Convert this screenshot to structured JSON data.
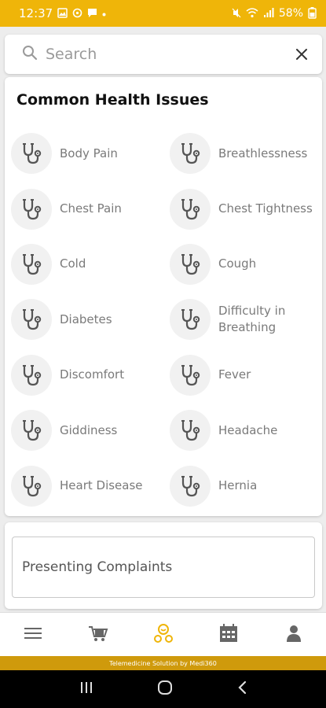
{
  "status_bar": {
    "time": "12:37",
    "battery": "58%",
    "bg_color": "#efb509"
  },
  "search": {
    "placeholder": "Search",
    "icon": "search-icon",
    "clear_icon": "close-icon"
  },
  "issues": {
    "title": "Common Health Issues",
    "icon": "stethoscope-icon",
    "items": [
      {
        "label": "Body Pain"
      },
      {
        "label": "Breathlessness"
      },
      {
        "label": "Chest Pain"
      },
      {
        "label": "Chest Tightness"
      },
      {
        "label": "Cold"
      },
      {
        "label": "Cough"
      },
      {
        "label": "Diabetes"
      },
      {
        "label": "Difficulty in Breathing"
      },
      {
        "label": "Discomfort"
      },
      {
        "label": "Fever"
      },
      {
        "label": "Giddiness"
      },
      {
        "label": "Headache"
      },
      {
        "label": "Heart Disease"
      },
      {
        "label": "Hernia"
      }
    ]
  },
  "complaints": {
    "label": "Presenting Complaints"
  },
  "bottom_nav": {
    "items": [
      {
        "icon": "menu-icon"
      },
      {
        "icon": "cart-icon"
      },
      {
        "icon": "consult-icon",
        "active": true,
        "active_color": "#efb509"
      },
      {
        "icon": "calendar-icon"
      },
      {
        "icon": "profile-icon"
      }
    ]
  },
  "footer": {
    "text": "Telemedicine Solution by Medi360",
    "bg_color": "#cf9a0c"
  },
  "android_nav": {
    "items": [
      {
        "icon": "recents-icon"
      },
      {
        "icon": "home-icon"
      },
      {
        "icon": "back-icon"
      }
    ]
  }
}
